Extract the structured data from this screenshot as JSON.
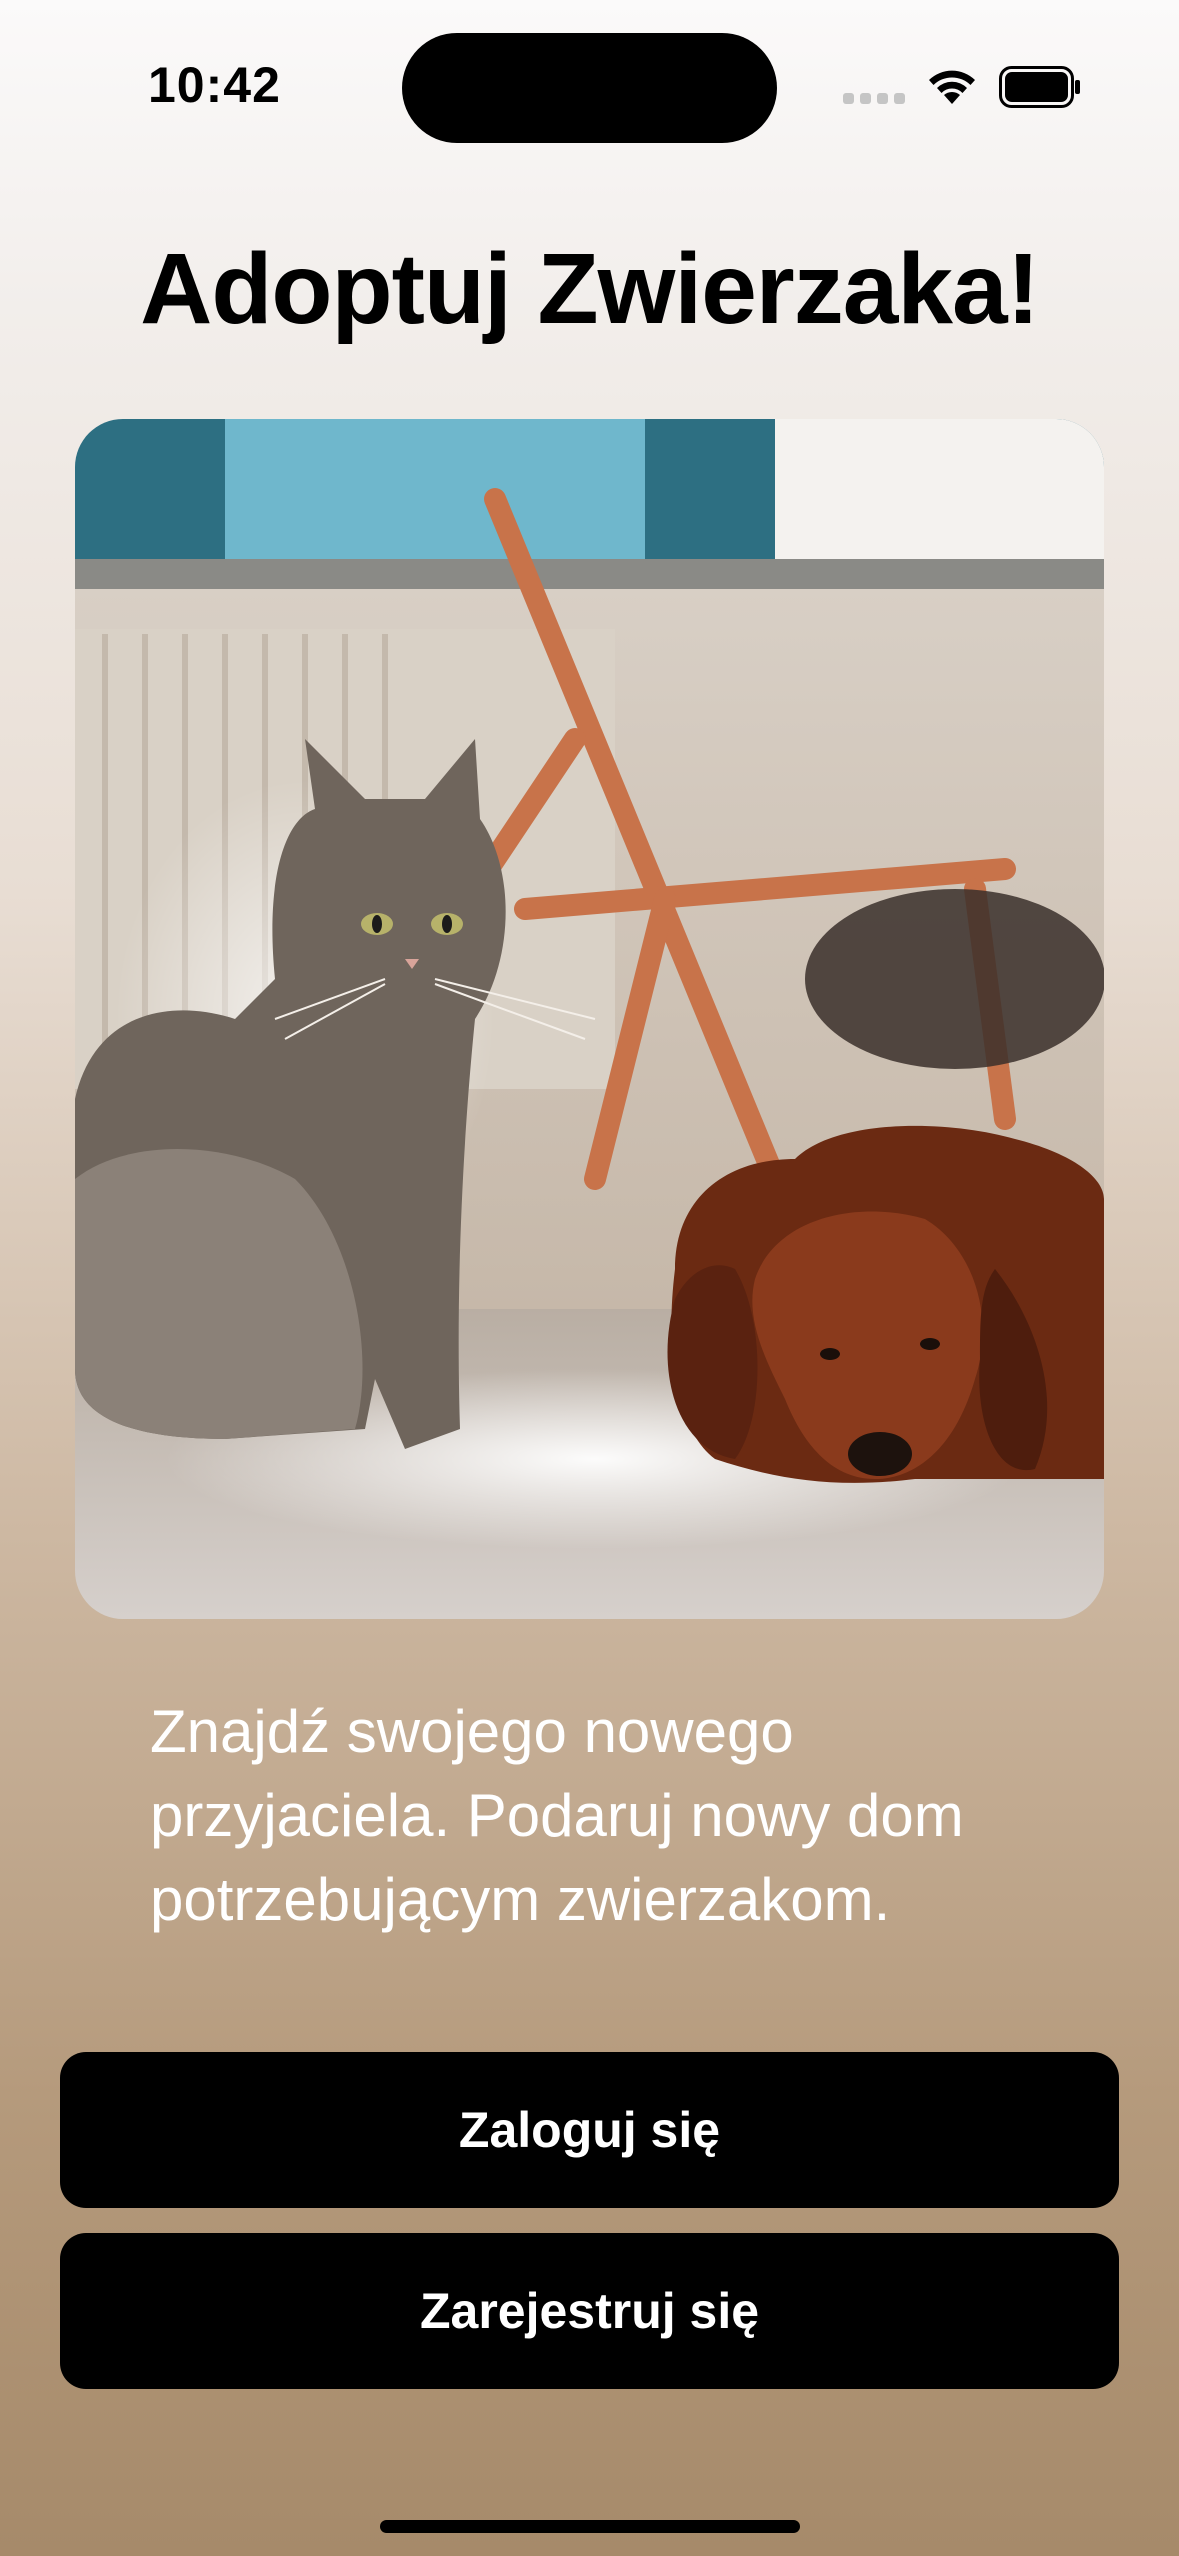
{
  "status_bar": {
    "time": "10:42",
    "icons": [
      "cellular-signal-icon",
      "wifi-icon",
      "battery-icon"
    ]
  },
  "page_title": "Adoptuj Zwierzaka!",
  "hero_image": {
    "subject": "cat sitting next to a dog lying on the floor"
  },
  "description": "Znajdź swojego nowego przyjaciela. Podaruj nowy dom potrzebującym zwierzakom.",
  "buttons": {
    "login_label": "Zaloguj się",
    "register_label": "Zarejestruj się"
  },
  "colors": {
    "background_top": "#fbfafa",
    "background_bottom": "#a68a6a",
    "button_bg": "#000000",
    "button_text": "#ffffff"
  }
}
